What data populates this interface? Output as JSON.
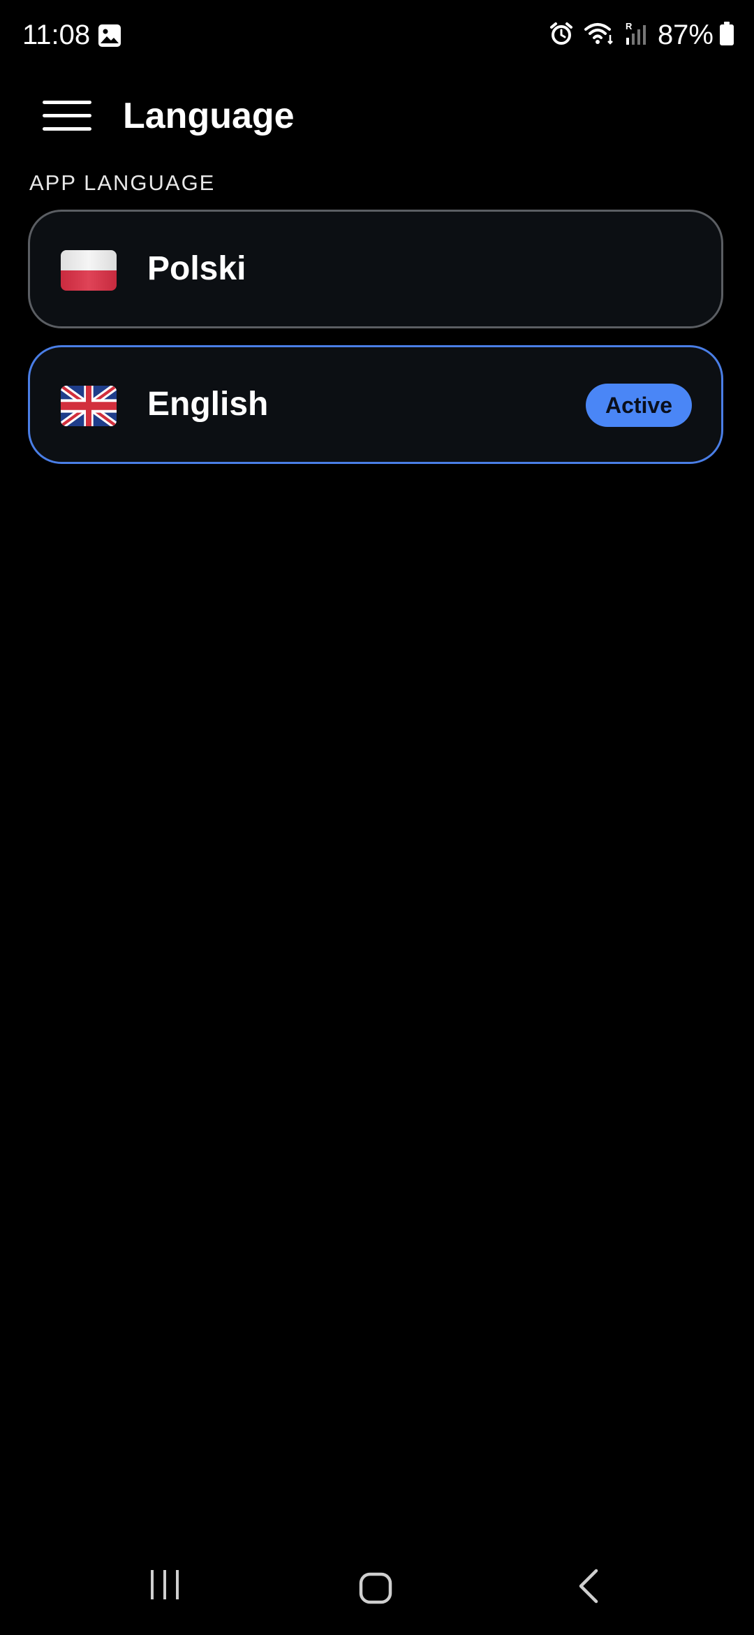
{
  "status_bar": {
    "time": "11:08",
    "battery": "87%",
    "icons": [
      "gallery-icon",
      "alarm-icon",
      "wifi-icon",
      "signal-icon",
      "battery-icon"
    ]
  },
  "header": {
    "title": "Language",
    "menu_icon": "hamburger-menu-icon"
  },
  "section": {
    "label": "APP LANGUAGE"
  },
  "languages": [
    {
      "name": "Polski",
      "flag": "poland-flag-icon",
      "active": false
    },
    {
      "name": "English",
      "flag": "uk-flag-icon",
      "active": true,
      "badge": "Active"
    }
  ],
  "nav_bar": {
    "icons": [
      "recents-icon",
      "home-icon",
      "back-icon"
    ]
  },
  "colors": {
    "background": "#000000",
    "card_background": "#0c0f13",
    "card_border": "#5b5e63",
    "active_border": "#4a7ee6",
    "badge_background": "#4a86f6"
  }
}
